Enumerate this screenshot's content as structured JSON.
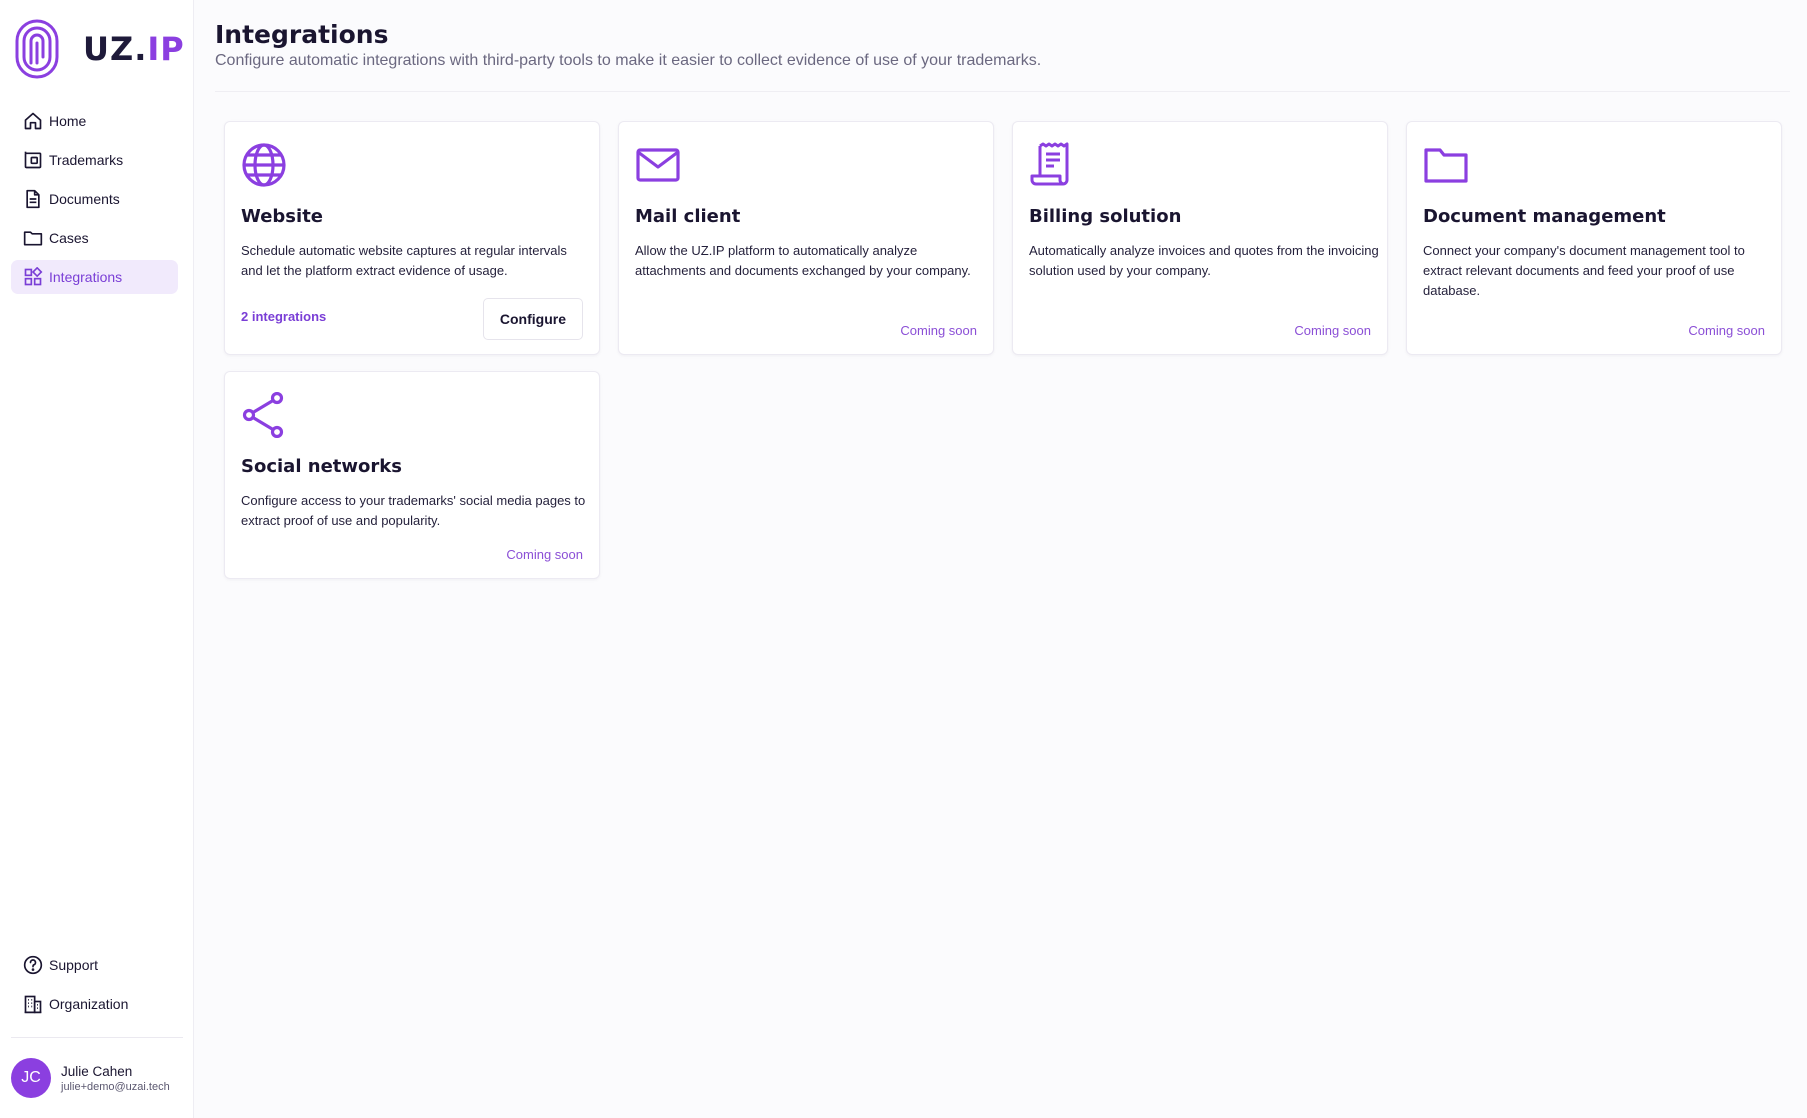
{
  "logo": {
    "text_main": "UZ",
    "text_dot": ".",
    "text_accent": "IP"
  },
  "sidebar": {
    "items": [
      {
        "label": "Home",
        "icon": "home-icon"
      },
      {
        "label": "Trademarks",
        "icon": "trademark-icon"
      },
      {
        "label": "Documents",
        "icon": "document-icon"
      },
      {
        "label": "Cases",
        "icon": "folder-icon"
      },
      {
        "label": "Integrations",
        "icon": "integrations-icon",
        "active": true
      }
    ],
    "bottom_items": [
      {
        "label": "Support",
        "icon": "help-icon"
      },
      {
        "label": "Organization",
        "icon": "building-icon"
      }
    ]
  },
  "user": {
    "initials": "JC",
    "name": "Julie Cahen",
    "email": "julie+demo@uzai.tech"
  },
  "header": {
    "title": "Integrations",
    "subtitle": "Configure automatic integrations with third-party tools to make it easier to collect evidence of use of your trademarks."
  },
  "cards": [
    {
      "icon": "globe-icon",
      "title": "Website",
      "description": "Schedule automatic website captures at regular intervals and let the platform extract evidence of usage.",
      "integrations_link": "2 integrations",
      "button_label": "Configure"
    },
    {
      "icon": "mail-icon",
      "title": "Mail client",
      "description": "Allow the UZ.IP platform to automatically analyze attachments and documents exchanged by your company.",
      "status": "Coming soon"
    },
    {
      "icon": "receipt-icon",
      "title": "Billing solution",
      "description": "Automatically analyze invoices and quotes from the invoicing solution used by your company.",
      "status": "Coming soon"
    },
    {
      "icon": "folder-icon",
      "title": "Document management",
      "description": "Connect your company's document management tool to extract relevant documents and feed your proof of use database.",
      "status": "Coming soon"
    },
    {
      "icon": "share-icon",
      "title": "Social networks",
      "description": "Configure access to your trademarks' social media pages to extract proof of use and popularity.",
      "status": "Coming soon"
    }
  ],
  "colors": {
    "accent": "#8b3fe0",
    "active_bg": "#f1eafc",
    "text": "#1a1530"
  }
}
